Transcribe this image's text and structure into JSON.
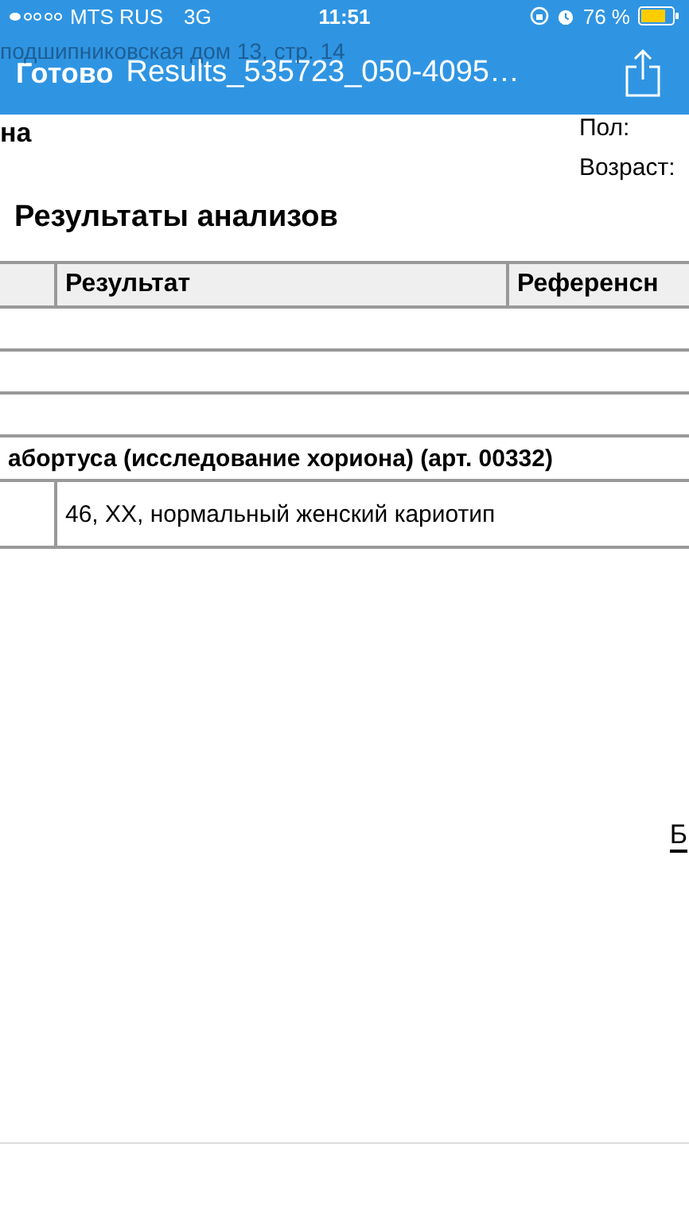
{
  "status_bar": {
    "carrier": "MTS RUS",
    "network": "3G",
    "time": "11:51",
    "battery": "76 %"
  },
  "nav_bar": {
    "done": "Готово",
    "title": "Results_535723_050-4095…"
  },
  "background_lines": [
    "подшипниковская дом 13, стр. 14"
  ],
  "document": {
    "name_fragment": "на",
    "fields": [
      "Пол:",
      "Возраст:"
    ],
    "heading": "Результаты анализов",
    "table": {
      "columns": [
        "",
        "Результат",
        "Референсн"
      ],
      "rows": [
        {
          "kind": "empty"
        },
        {
          "kind": "empty"
        },
        {
          "kind": "empty"
        },
        {
          "kind": "section",
          "text": "абортуса (исследование хориона) (арт. 00332)"
        },
        {
          "kind": "data",
          "cells": [
            "",
            "46, XX, нормальный женский кариотип",
            ""
          ]
        }
      ]
    },
    "edge_letter": "Б"
  }
}
